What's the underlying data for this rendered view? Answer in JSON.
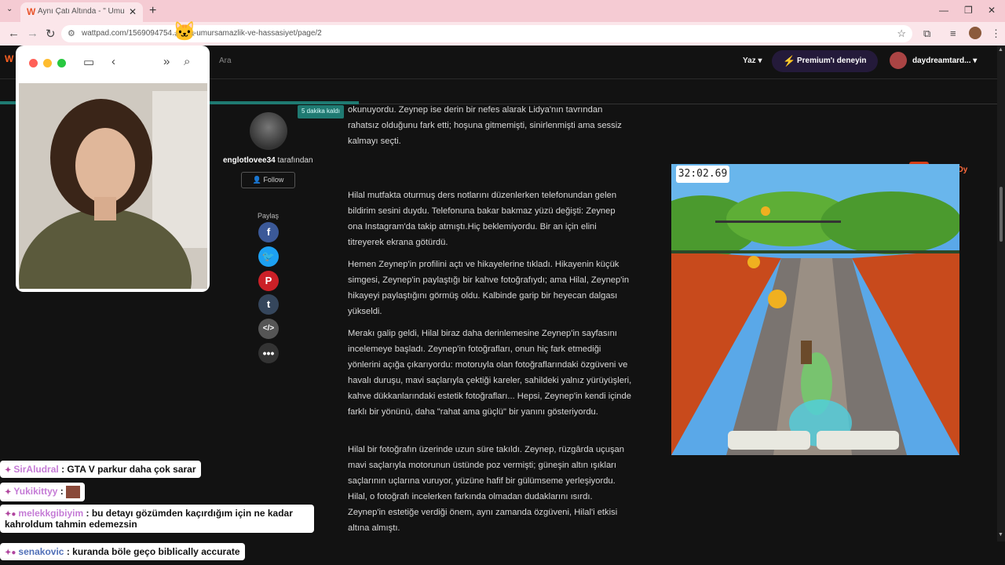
{
  "tab": {
    "title": "Aynı Çatı Altında - \" Umursamaz",
    "favicon": "W"
  },
  "address": {
    "url": "wattpad.com/1569094754...ında-umursamazlik-ve-hassasiyet/page/2"
  },
  "header": {
    "search_label": "Ara",
    "write_label": "Yaz",
    "premium_label": "Premium'ı deneyin",
    "username": "daydreamtard..."
  },
  "reader": {
    "time_left": "5 dakika kaldı",
    "add_label": "+",
    "vote_label": "Oy",
    "progress_percent": 36
  },
  "author": {
    "name": "englotlovee34",
    "suffix": " tarafından",
    "follow_label": "Follow",
    "share_label": "Paylaş",
    "share_icons": [
      "facebook-icon",
      "twitter-icon",
      "pinterest-icon",
      "tumblr-icon",
      "embed-icon",
      "more-icon"
    ]
  },
  "article": {
    "p1": "okunuyordu. Zeynep ise derin bir nefes alarak Lidya'nın tavrından rahatsız olduğunu fark etti; hoşuna gitmemişti, sinirlenmişti ama sessiz kalmayı seçti.",
    "p2": "Hilal mutfakta oturmuş ders notlarını düzenlerken telefonundan gelen bildirim sesini duydu. Telefonuna bakar bakmaz yüzü değişti: Zeynep ona Instagram'da takip atmıştı.Hiç beklemiyordu. Bir an için elini titreyerek ekrana götürdü.",
    "p3": "Hemen Zeynep'in profilini açtı ve hikayelerine tıkladı. Hikayenin küçük simgesi, Zeynep'in paylaştığı bir kahve fotoğrafıydı; ama Hilal, Zeynep'in hikayeyi paylaştığını görmüş oldu. Kalbinde garip bir heyecan dalgası yükseldi.",
    "p4": "Merakı galip geldi, Hilal biraz daha derinlemesine Zeynep'in sayfasını incelemeye başladı. Zeynep'in fotoğrafları, onun hiç fark etmediği yönlerini açığa çıkarıyordu: motoruyla olan fotoğraflarındaki özgüveni ve havalı duruşu, mavi saçlarıyla çektiği kareler, sahildeki yalnız yürüyüşleri, kahve dükkanlarındaki estetik fotoğrafları... Hepsi, Zeynep'in kendi içinde farklı bir yönünü, daha \"rahat ama güçlü\" bir yanını gösteriyordu.",
    "p5": "Hilal bir fotoğrafın üzerinde uzun süre takıldı. Zeynep, rüzgârda uçuşan mavi saçlarıyla motorunun üstünde poz vermişti; güneşin altın ışıkları saçlarının uçlarına vuruyor, yüzüne hafif bir gülümseme yerleşiyordu. Hilal, o fotoğrafı incelerken farkında olmadan dudaklarını ısırdı. Zeynep'in estetiğe verdiği önem, aynı zamanda özgüveni, Hilal'i etkisi altına almıştı."
  },
  "game": {
    "timer": "32:02.69"
  },
  "chat": [
    {
      "user": "SirAludral",
      "message": ": GTA V parkur daha çok sarar"
    },
    {
      "user": "Yukikittyy",
      "message": ":"
    },
    {
      "user": "melekkgibiyim",
      "message": ": bu detayı gözümden kaçırdığım için ne kadar kahroldum tahmin edemezsin"
    },
    {
      "user": "senakovic",
      "message": ": kuranda böle geço biblically accurate"
    }
  ],
  "colors": {
    "accent": "#ff6122",
    "teal": "#1f7a72",
    "premium": "#c866ff",
    "tab_bg": "#f5cbd3"
  }
}
